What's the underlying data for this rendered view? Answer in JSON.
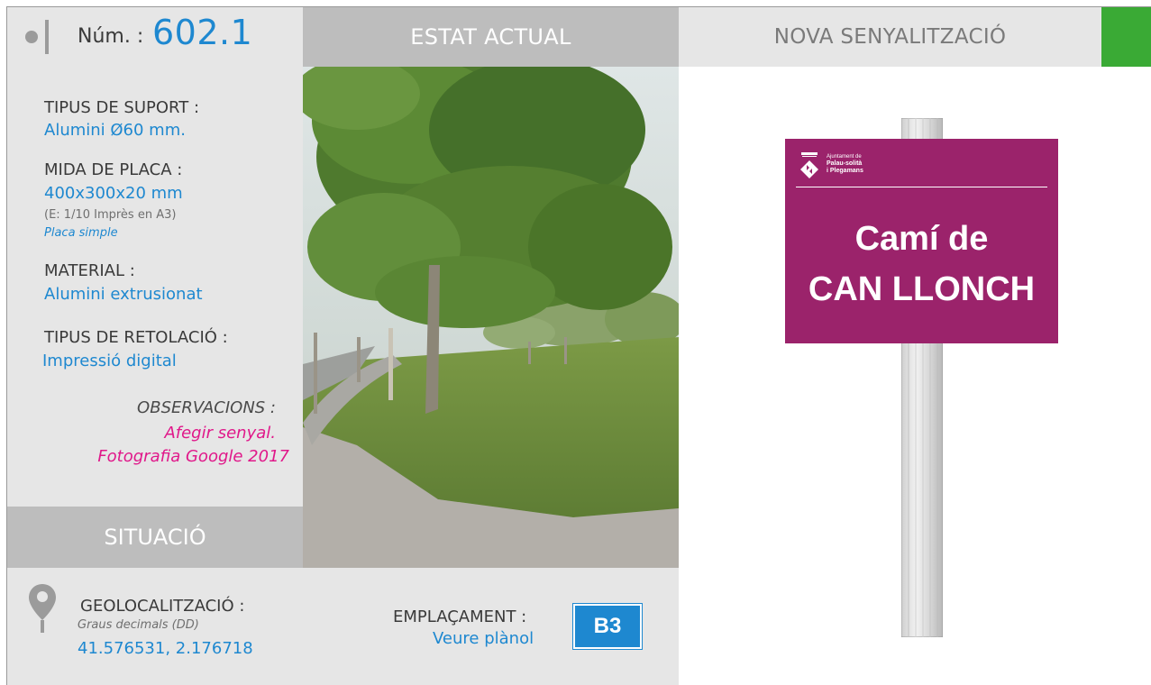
{
  "header": {
    "num_label": "Núm. :",
    "num_value": "602.1",
    "estat_label": "ESTAT ACTUAL",
    "nova_label": "NOVA SENYALITZACIÓ"
  },
  "specs": {
    "suport_label": "TIPUS DE SUPORT :",
    "suport_value": "Alumini Ø60 mm.",
    "mida_label": "MIDA DE PLACA :",
    "mida_value": "400x300x20 mm",
    "mida_scale": "(E: 1/10 Imprès en A3)",
    "mida_type": "Placa simple",
    "material_label": "MATERIAL :",
    "material_value": "Alumini extrusionat",
    "retolacio_label": "TIPUS DE RETOLACIÓ :",
    "retolacio_value": "Impressió digital",
    "observacions_label": "OBSERVACIONS :",
    "observacions_line1": "Afegir senyal.",
    "observacions_line2": "Fotografia Google 2017"
  },
  "situacio_label": "SITUACIÓ",
  "location": {
    "geo_label": "GEOLOCALITZACIÓ :",
    "geo_format": "Graus decimals (DD)",
    "geo_value": "41.576531, 2.176718",
    "emplacament_label": "EMPLAÇAMENT :",
    "emplacament_link": "Veure plànol",
    "emplacament_code": "B3"
  },
  "sign": {
    "logo_line1": "Ajuntament de",
    "logo_line2": "Palau-solità",
    "logo_line3": "i Plegamans",
    "title_line1": "Camí de",
    "title_line2": "CAN LLONCH",
    "plate_color": "#9b236b"
  },
  "colors": {
    "accent_blue": "#1e88d0",
    "accent_pink": "#e0188a",
    "accent_green": "#3aaa35"
  }
}
